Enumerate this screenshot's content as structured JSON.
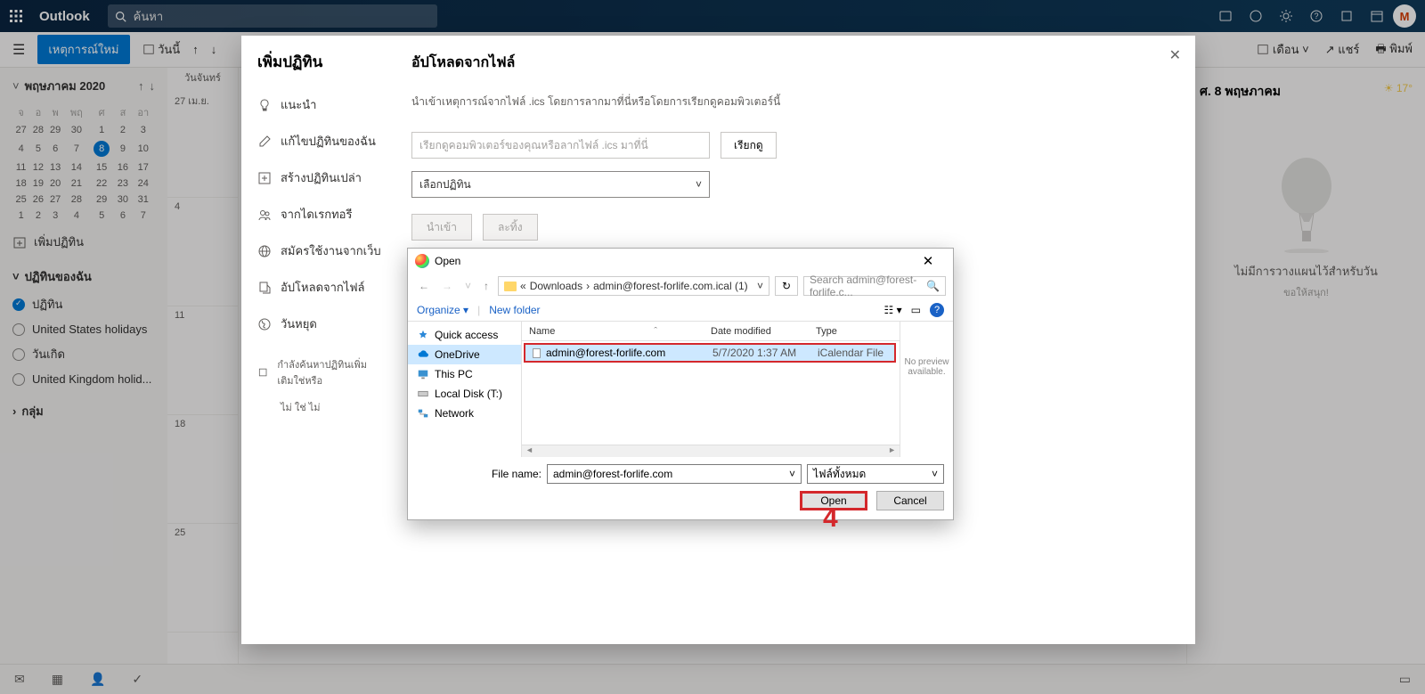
{
  "topbar": {
    "brand": "Outlook",
    "search_placeholder": "ค้นหา",
    "avatar_initials": "M"
  },
  "toolbar2": {
    "new_event": "เหตุการณ์ใหม่",
    "today": "วันนี้",
    "view_month": "เดือน",
    "share": "แชร์",
    "print": "พิมพ์"
  },
  "left": {
    "month_title": "พฤษภาคม 2020",
    "dow": [
      "จ",
      "อ",
      "พ",
      "พฤ",
      "ศ",
      "ส",
      "อา"
    ],
    "weeks": [
      [
        "27",
        "28",
        "29",
        "30",
        "1",
        "2",
        "3"
      ],
      [
        "4",
        "5",
        "6",
        "7",
        "8",
        "9",
        "10"
      ],
      [
        "11",
        "12",
        "13",
        "14",
        "15",
        "16",
        "17"
      ],
      [
        "18",
        "19",
        "20",
        "21",
        "22",
        "23",
        "24"
      ],
      [
        "25",
        "26",
        "27",
        "28",
        "29",
        "30",
        "31"
      ],
      [
        "1",
        "2",
        "3",
        "4",
        "5",
        "6",
        "7"
      ]
    ],
    "today": "8",
    "add_cal": "เพิ่มปฏิทิน",
    "my_cals": "ปฏิทินของฉัน",
    "cals": [
      {
        "label": "ปฏิทิน",
        "checked": true
      },
      {
        "label": "United States holidays",
        "checked": false
      },
      {
        "label": "วันเกิด",
        "checked": false
      },
      {
        "label": "United Kingdom holid...",
        "checked": false
      }
    ],
    "group": "กลุ่ม"
  },
  "timecol": {
    "header": "วันจันทร์",
    "rows": [
      "27 เม.ย.",
      "4",
      "11",
      "18",
      "25"
    ]
  },
  "right": {
    "date": "ศ. 8 พฤษภาคม",
    "temp": "17°",
    "no_plan": "ไม่มีการวางแผนไว้สำหรับวัน",
    "enjoy": "ขอให้สนุก!"
  },
  "modal": {
    "left_title": "เพิ่มปฏิทิน",
    "items": [
      {
        "icon": "lightbulb",
        "label": "แนะนำ"
      },
      {
        "icon": "edit",
        "label": "แก้ไขปฏิทินของฉัน"
      },
      {
        "icon": "plus-square",
        "label": "สร้างปฏิทินเปล่า"
      },
      {
        "icon": "people",
        "label": "จากไดเรกทอรี"
      },
      {
        "icon": "globe",
        "label": "สมัครใช้งานจากเว็บ"
      },
      {
        "icon": "upload",
        "label": "อัปโหลดจากไฟล์"
      },
      {
        "icon": "earth",
        "label": "วันหยุด"
      }
    ],
    "search_hint": "กำลังค้นหาปฏิทินเพิ่มเติมใช่หรือ",
    "search_opts": "ไม่    ใช่   ไม่",
    "right_title": "อัปโหลดจากไฟล์",
    "desc": "นำเข้าเหตุการณ์จากไฟล์ .ics โดยการลากมาที่นี่หรือโดยการเรียกดูคอมพิวเตอร์นี้",
    "file_placeholder": "เรียกดูคอมพิวเตอร์ของคุณหรือลากไฟล์ .ics มาที่นี่",
    "browse": "เรียกดู",
    "select_placeholder": "เลือกปฏิทิน",
    "import": "นำเข้า",
    "cancel": "ละทิ้ง"
  },
  "fdialog": {
    "title": "Open",
    "path_seg1": "Downloads",
    "path_seg2": "admin@forest-forlife.com.ical (1)",
    "search_placeholder": "Search admin@forest-forlife.c...",
    "organize": "Organize",
    "new_folder": "New folder",
    "side": [
      {
        "icon": "star",
        "label": "Quick access",
        "color": "#2b88d8"
      },
      {
        "icon": "cloud",
        "label": "OneDrive",
        "color": "#0078d4",
        "selected": true
      },
      {
        "icon": "monitor",
        "label": "This PC",
        "color": "#3a91d0"
      },
      {
        "icon": "disk",
        "label": "Local Disk (T:)",
        "color": "#888"
      },
      {
        "icon": "network",
        "label": "Network",
        "color": "#3a91d0"
      }
    ],
    "col_name": "Name",
    "col_date": "Date modified",
    "col_type": "Type",
    "row_name": "admin@forest-forlife.com",
    "row_date": "5/7/2020 1:37 AM",
    "row_type": "iCalendar File",
    "no_preview": "No preview available.",
    "fn_label": "File name:",
    "fn_value": "admin@forest-forlife.com",
    "filter": "ไฟล์ทั้งหมด",
    "open": "Open",
    "cancel": "Cancel",
    "annot": "4"
  }
}
